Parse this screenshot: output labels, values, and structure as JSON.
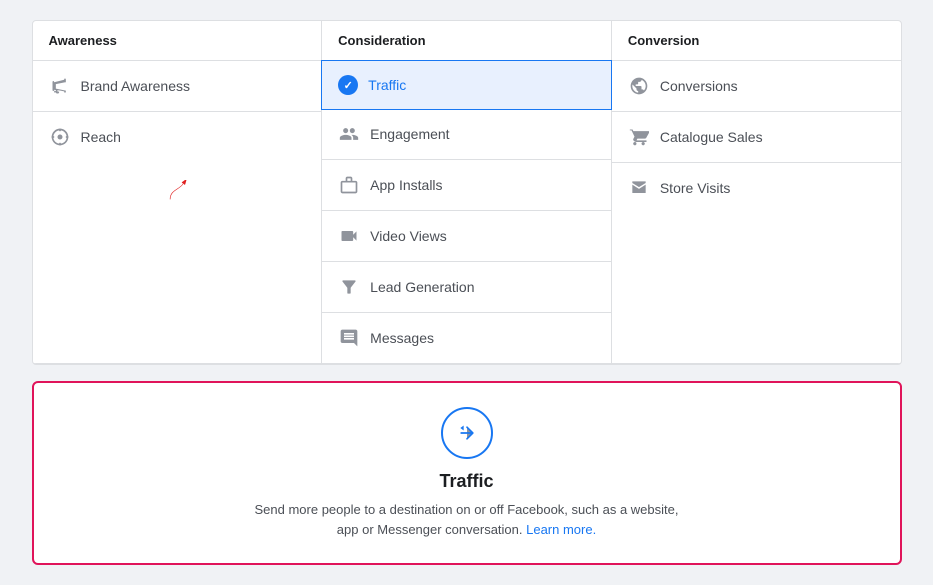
{
  "columns": [
    {
      "id": "awareness",
      "header": "Awareness",
      "items": [
        {
          "id": "brand-awareness",
          "label": "Brand Awareness",
          "icon": "megaphone"
        },
        {
          "id": "reach",
          "label": "Reach",
          "icon": "asterisk"
        }
      ]
    },
    {
      "id": "consideration",
      "header": "Consideration",
      "items": [
        {
          "id": "traffic",
          "label": "Traffic",
          "icon": "check",
          "selected": true
        },
        {
          "id": "engagement",
          "label": "Engagement",
          "icon": "people"
        },
        {
          "id": "app-installs",
          "label": "App Installs",
          "icon": "box"
        },
        {
          "id": "video-views",
          "label": "Video Views",
          "icon": "video"
        },
        {
          "id": "lead-generation",
          "label": "Lead Generation",
          "icon": "funnel"
        },
        {
          "id": "messages",
          "label": "Messages",
          "icon": "chat"
        }
      ]
    },
    {
      "id": "conversion",
      "header": "Conversion",
      "items": [
        {
          "id": "conversions",
          "label": "Conversions",
          "icon": "globe"
        },
        {
          "id": "catalogue-sales",
          "label": "Catalogue Sales",
          "icon": "cart"
        },
        {
          "id": "store-visits",
          "label": "Store Visits",
          "icon": "store"
        }
      ]
    }
  ],
  "description": {
    "title": "Traffic",
    "text": "Send more people to a destination on or off Facebook, such as a website,\napp or Messenger conversation.",
    "link_text": "Learn more.",
    "link_href": "#"
  }
}
